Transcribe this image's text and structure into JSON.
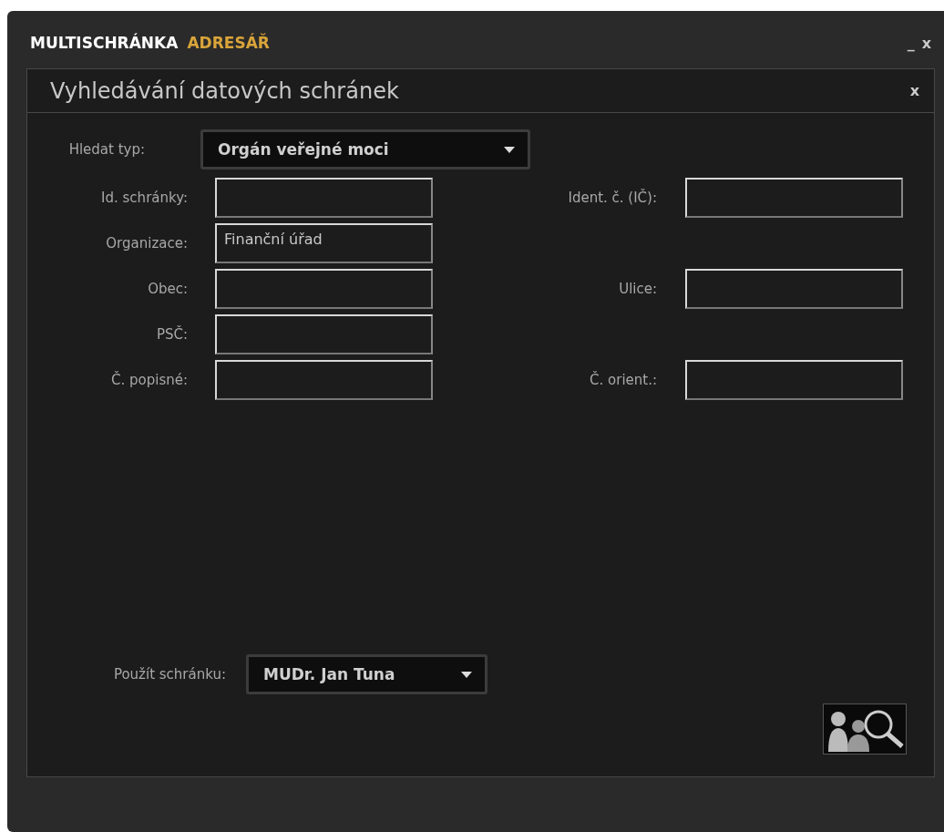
{
  "window": {
    "title": "MULTISCHRÁNKA",
    "subtitle": "ADRESÁŘ",
    "minimize": "_",
    "close": "x"
  },
  "panel": {
    "title": "Vyhledávání datových schránek",
    "close": "x"
  },
  "search_type": {
    "label": "Hledat typ:",
    "value": "Orgán veřejné moci"
  },
  "rows": [
    {
      "left": {
        "label": "Id. schránky:"
      },
      "right": {
        "label": "Ident. č. (IČ):"
      }
    },
    {
      "left": {
        "label": "Organizace:",
        "value": "Finanční úřad"
      }
    },
    {
      "left": {
        "label": "Obec:"
      },
      "right": {
        "label": "Ulice:"
      }
    },
    {
      "left": {
        "label": "PSČ:"
      }
    },
    {
      "left": {
        "label": "Č. popisné:"
      },
      "right": {
        "label": "Č. orient.:"
      }
    }
  ],
  "use_box": {
    "label": "Použít schránku:",
    "value": "MUDr. Jan Tuna"
  }
}
